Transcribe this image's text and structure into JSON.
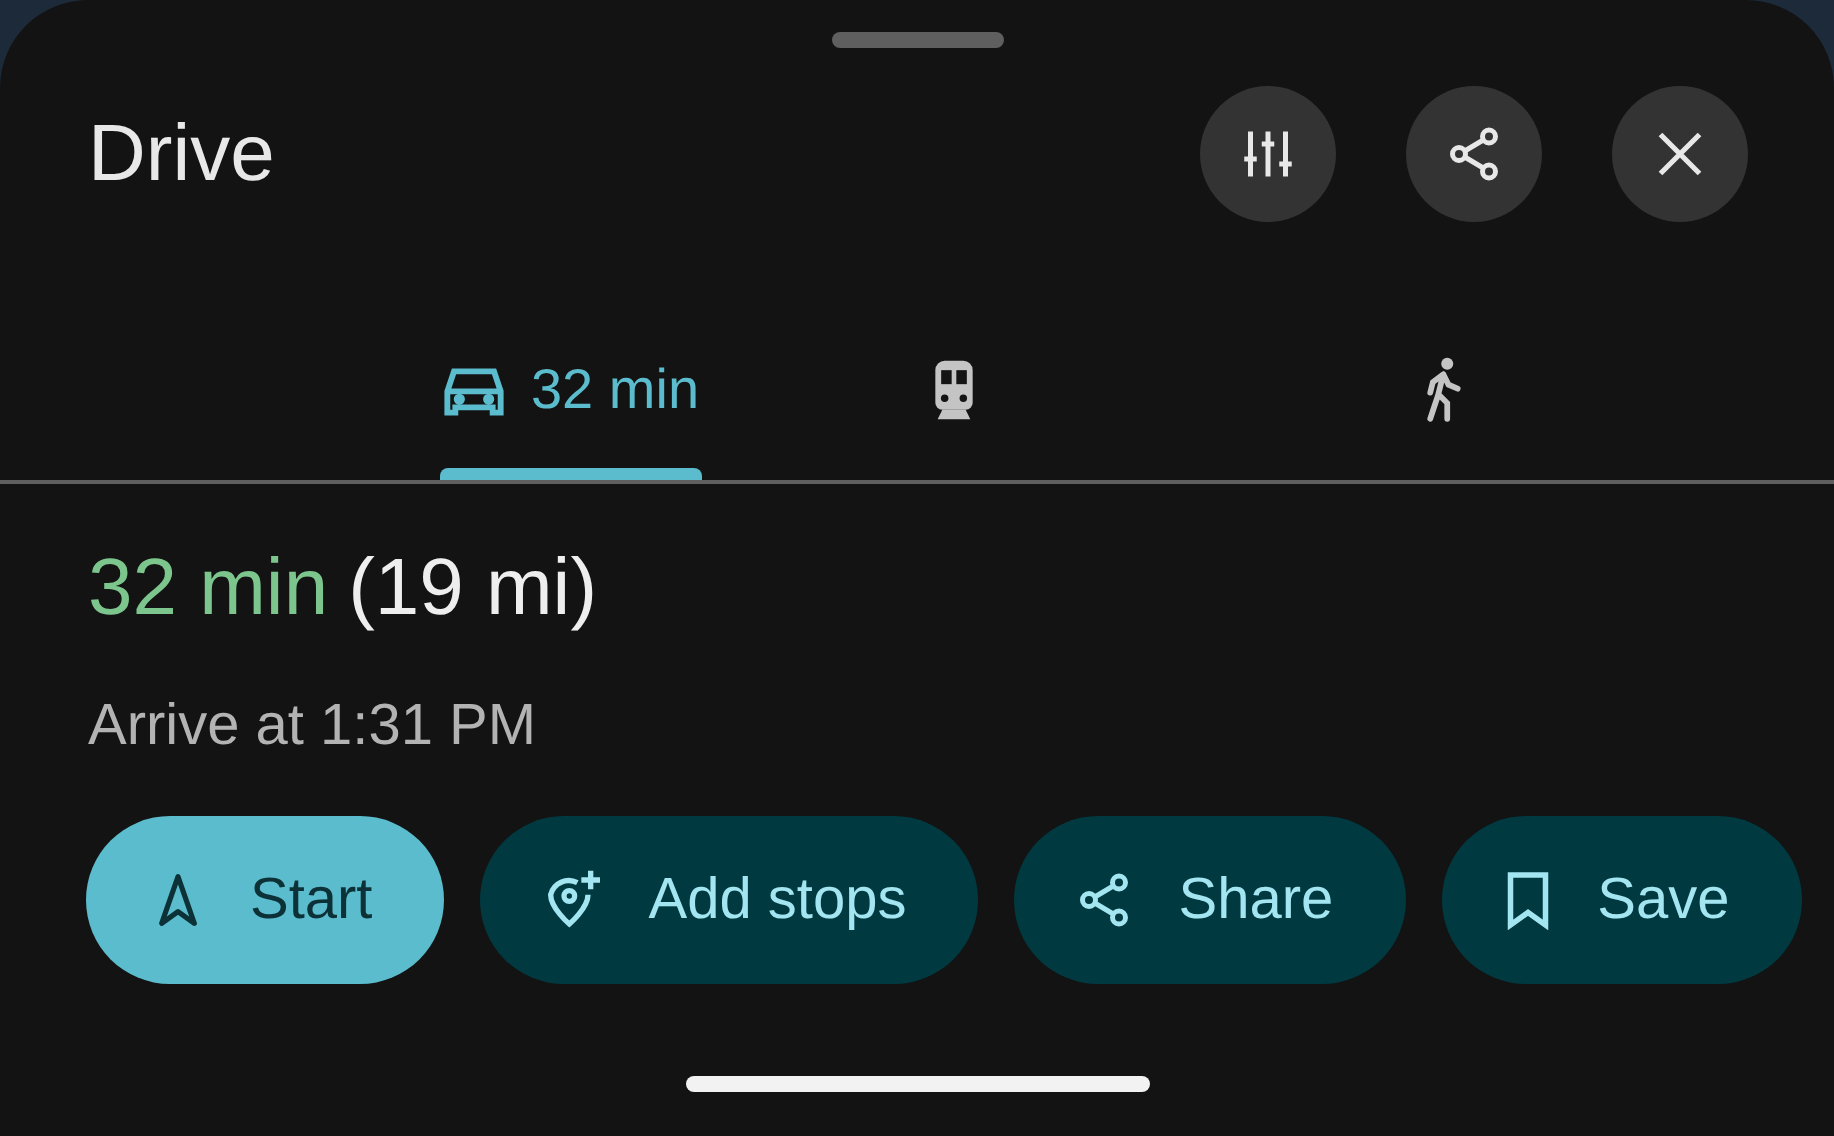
{
  "title": "Drive",
  "header_buttons": [
    {
      "kind": "options"
    },
    {
      "kind": "share"
    },
    {
      "kind": "close"
    }
  ],
  "tabs": [
    {
      "kind": "car",
      "label": "32 min",
      "selected": true
    },
    {
      "kind": "transit",
      "selected": false
    },
    {
      "kind": "walk",
      "selected": false
    }
  ],
  "summary": {
    "duration": "32 min",
    "distance": "(19 mi)",
    "arrival": "Arrive at 1:31 PM"
  },
  "actions": [
    {
      "kind": "start",
      "label": "Start",
      "primary": true
    },
    {
      "kind": "add_stops",
      "label": "Add stops",
      "primary": false
    },
    {
      "kind": "share",
      "label": "Share",
      "primary": false
    },
    {
      "kind": "save",
      "label": "Save",
      "primary": false
    }
  ]
}
